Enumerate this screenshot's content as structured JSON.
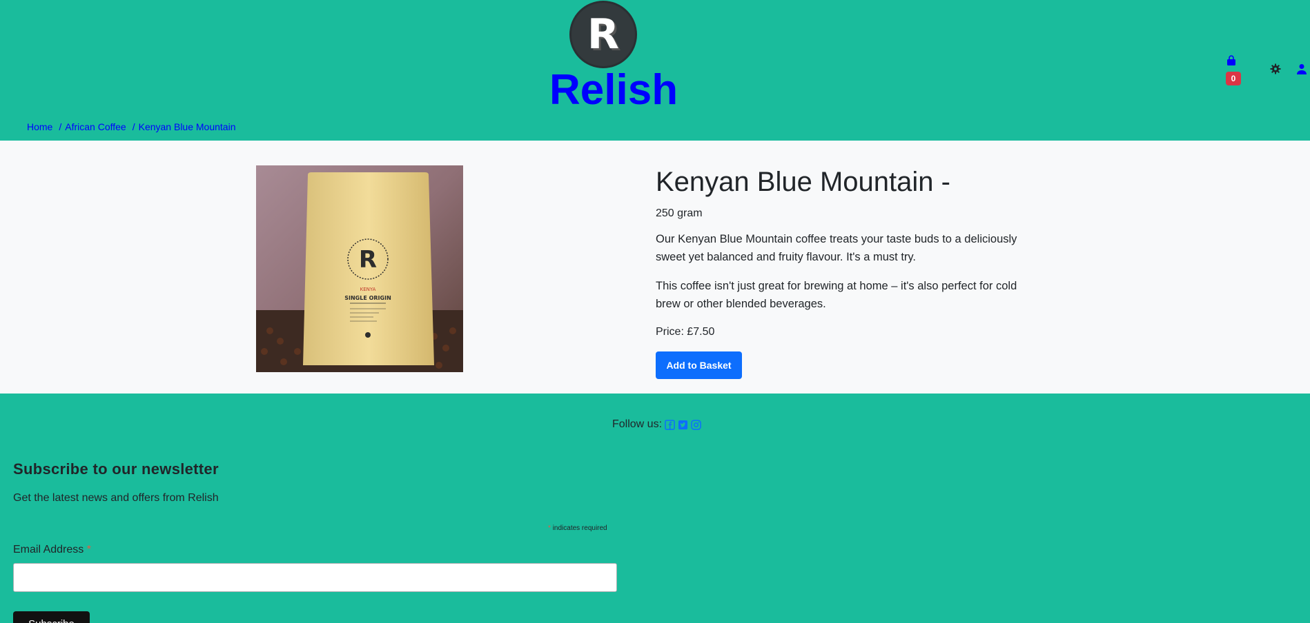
{
  "header": {
    "logo_letter": "R",
    "brand": "Relish",
    "basket_count": "0",
    "icons": [
      "basket-icon",
      "gear-icon",
      "user-icon"
    ]
  },
  "breadcrumb": {
    "items": [
      "Home",
      "African Coffee",
      "Kenyan Blue Mountain"
    ],
    "separator": "/"
  },
  "product": {
    "title": "Kenyan Blue Mountain -",
    "size": "250 gram",
    "description_1": "Our Kenyan Blue Mountain coffee treats your taste buds to a deliciously sweet yet balanced and fruity flavour. It's a must try.",
    "description_2": "This coffee isn't just great for brewing at home – it's also perfect for cold brew or other blended beverages.",
    "price": "Price: £7.50",
    "add_button": "Add to Basket",
    "image_alt": "Kenya single origin coffee bag",
    "bag_text": {
      "origin": "KENYA",
      "label": "SINGLE ORIGIN"
    }
  },
  "footer": {
    "follow_label": "Follow us:",
    "social_icons": [
      "facebook-icon",
      "twitter-icon",
      "instagram-icon"
    ],
    "newsletter_title": "Subscribe to our newsletter",
    "newsletter_subtitle": "Get the latest news and offers from Relish",
    "required_star": "*",
    "required_note": "indicates required",
    "email_label": "Email Address",
    "email_value": "",
    "subscribe_button": "Subscribe"
  },
  "colors": {
    "brand_green": "#1abc9c",
    "brand_blue": "#0000ff",
    "button_blue": "#0d6efd",
    "badge_red": "#dc3545"
  }
}
